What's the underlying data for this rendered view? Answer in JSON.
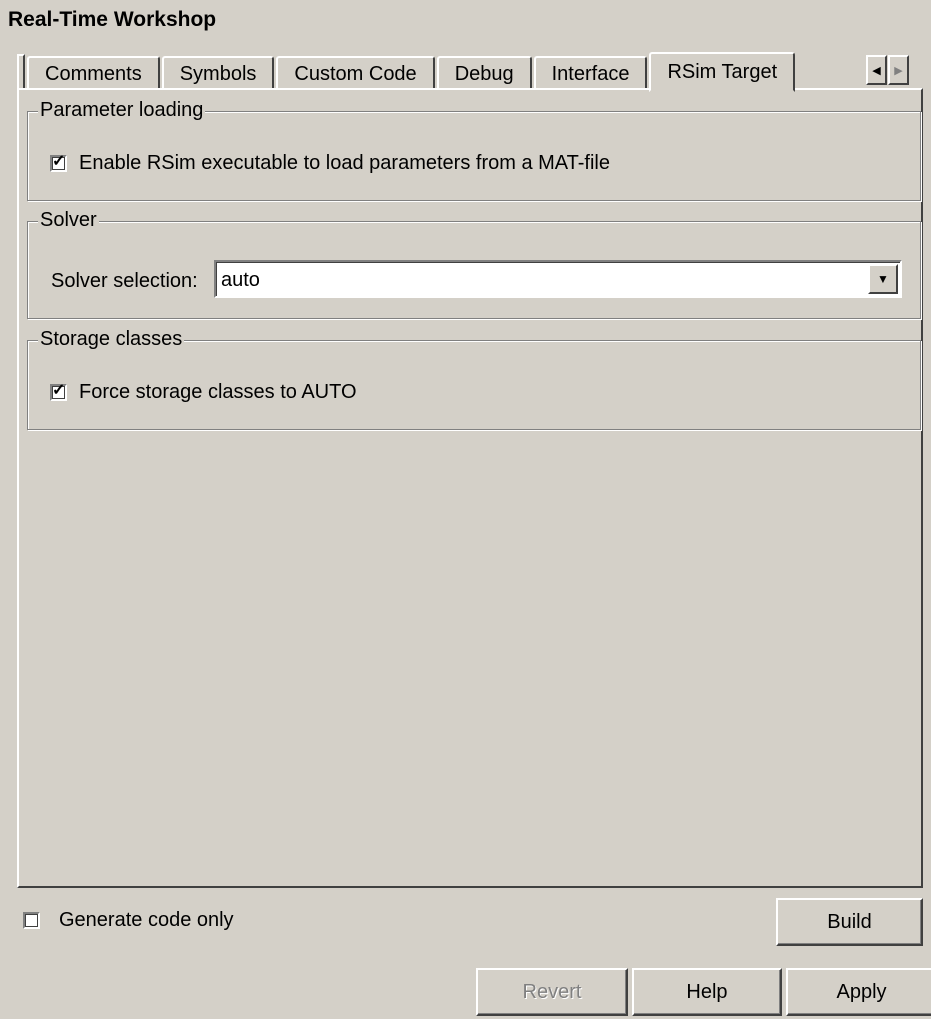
{
  "window": {
    "title": "Real-Time Workshop"
  },
  "tabs": [
    {
      "label": "Comments"
    },
    {
      "label": "Symbols"
    },
    {
      "label": "Custom Code"
    },
    {
      "label": "Debug"
    },
    {
      "label": "Interface"
    },
    {
      "label": "RSim Target",
      "active": true
    }
  ],
  "tab_scroll": {
    "left_icon": "triangle-left-icon",
    "right_icon": "triangle-right-icon"
  },
  "parameter_loading": {
    "legend": "Parameter loading",
    "checkbox_label": "Enable RSim executable to load parameters from a MAT-file",
    "checked": true
  },
  "solver": {
    "legend": "Solver",
    "label": "Solver selection:",
    "value": "auto"
  },
  "storage_classes": {
    "legend": "Storage classes",
    "checkbox_label": "Force storage classes to AUTO",
    "checked": true
  },
  "bottom": {
    "generate_code_only_label": "Generate code only",
    "generate_code_only_checked": false,
    "build_label": "Build",
    "revert_label": "Revert",
    "help_label": "Help",
    "apply_label": "Apply"
  }
}
